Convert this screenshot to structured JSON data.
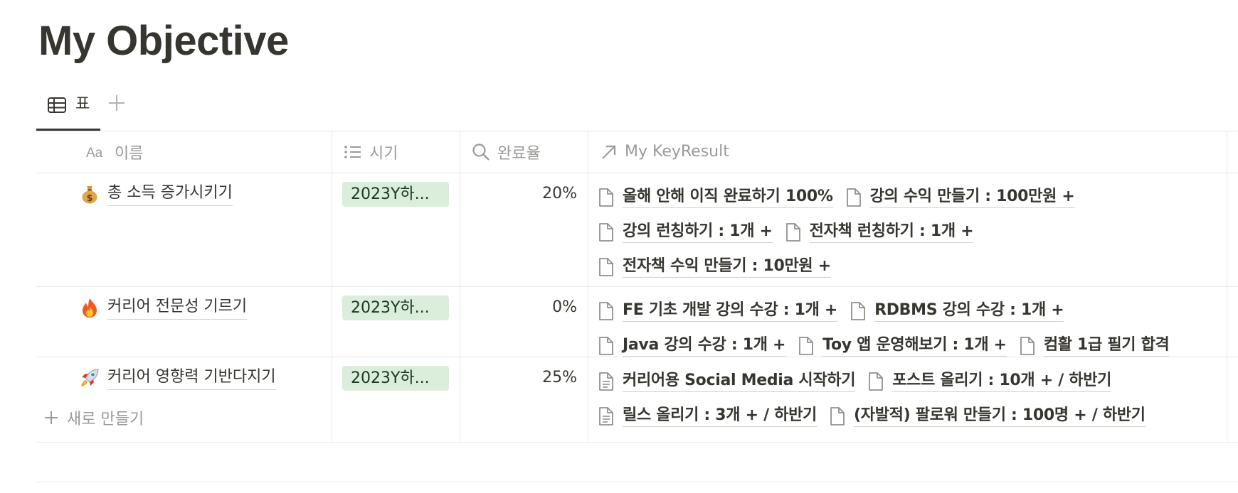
{
  "page": {
    "title": "My Objective"
  },
  "view_tabs": [
    {
      "label": "표",
      "icon": "table-icon",
      "active": true
    }
  ],
  "add_view_icon": "plus-icon",
  "columns": [
    {
      "label": "이름",
      "icon": "text-property-icon"
    },
    {
      "label": "시기",
      "icon": "list-property-icon"
    },
    {
      "label": "완료율",
      "icon": "search-icon"
    },
    {
      "label": "My KeyResult",
      "icon": "relation-arrow-icon"
    }
  ],
  "rows": [
    {
      "emoji": "money-bag-icon",
      "name": "총 소득 증가시키기",
      "period": "2023Y하...",
      "completion": "20%",
      "key_results": [
        [
          "올해 안해 이직 완료하기 100%",
          "강의 수익 만들기 : 100만원 +"
        ],
        [
          "강의 런칭하기 : 1개 +",
          "전자책 런칭하기 : 1개 +"
        ],
        [
          "전자책 수익 만들기 : 10만원 +"
        ]
      ]
    },
    {
      "emoji": "fire-icon",
      "name": "커리어 전문성 기르기",
      "period": "2023Y하...",
      "completion": "0%",
      "key_results": [
        [
          "FE 기초 개발 강의 수강 : 1개 +",
          "RDBMS 강의 수강 : 1개 +"
        ],
        [
          "Java 강의 수강 : 1개 +",
          "Toy 앱 운영해보기 : 1개 +",
          "컴활 1급 필기 합격"
        ]
      ]
    },
    {
      "emoji": "rocket-icon",
      "name": "커리어 영향력 기반다지기",
      "period": "2023Y하...",
      "completion": "25%",
      "key_results": [
        [
          "커리어용 Social Media 시작하기",
          "포스트 올리기 : 10개 + / 하반기"
        ],
        [
          "릴스 올리기 : 3개 + / 하반기",
          "(자발적) 팔로워 만들기 : 100명 + / 하반기"
        ]
      ]
    }
  ],
  "new_row": {
    "label": "새로 만들기",
    "icon": "plus-icon"
  },
  "colors": {
    "tag_bg": "#dbeddb",
    "tag_text": "#1c3829",
    "text": "#37352f",
    "muted": "#9b9a97",
    "border": "#e9e9e7"
  }
}
